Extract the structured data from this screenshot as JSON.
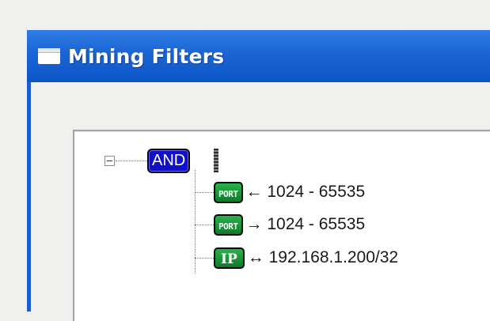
{
  "window": {
    "title": "Mining Filters",
    "title_icon": "window-icon"
  },
  "tree": {
    "root": {
      "label": "AND",
      "expanded": true,
      "expander_icon": "collapse-minus-icon"
    },
    "children": [
      {
        "badge": "PORT",
        "direction": "←",
        "value": "1024 - 65535"
      },
      {
        "badge": "PORT",
        "direction": "→",
        "value": "1024 - 65535"
      },
      {
        "badge": "IP",
        "direction": "↔",
        "value": "192.168.1.200/32"
      }
    ]
  },
  "colors": {
    "titlebar": "#1a64d3",
    "and_badge": "#1010c8",
    "filter_badge": "#0e7a2a"
  }
}
